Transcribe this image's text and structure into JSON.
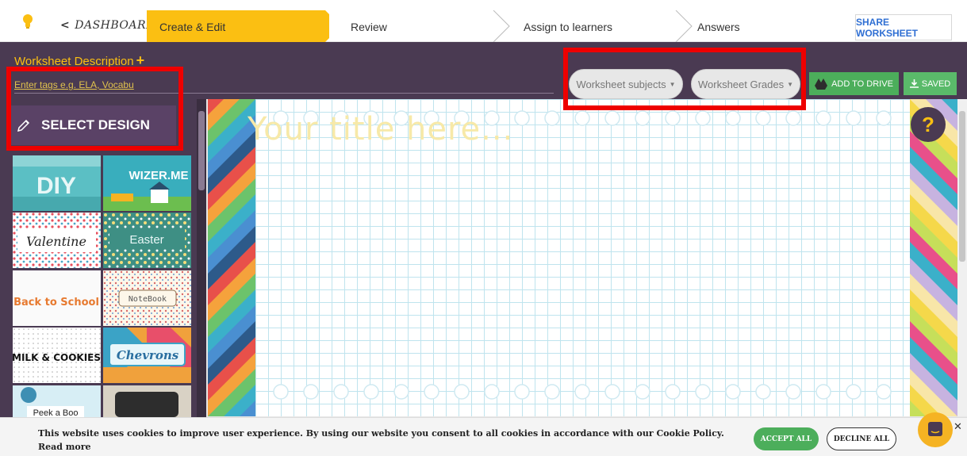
{
  "topnav": {
    "dashboard_label": "DASHBOARD",
    "steps": [
      "Create & Edit",
      "Review",
      "Assign to learners",
      "Answers"
    ],
    "share_label": "SHARE WORKSHEET"
  },
  "toolbar": {
    "description_label": "Worksheet Description",
    "tags_placeholder": "Enter tags e.g. ELA, Vocabu",
    "subjects_label": "Worksheet subjects",
    "grades_label": "Worksheet Grades",
    "drive_label": "ADD TO DRIVE",
    "saved_label": "SAVED"
  },
  "sidebar": {
    "select_design_label": "SELECT DESIGN",
    "designs": [
      "DIY",
      "WIZER.ME",
      "Valentine",
      "Easter",
      "Back to School",
      "NoteBook",
      "MILK & COOKIES",
      "Chevrons",
      "Peek a Boo",
      ""
    ]
  },
  "canvas": {
    "title_placeholder": "Your title here...",
    "help_label": "?"
  },
  "cookie": {
    "message": "This website uses cookies to improve user experience. By using our website you consent to all cookies in accordance with our Cookie Policy.",
    "read_more": "Read more",
    "accept_label": "ACCEPT ALL",
    "decline_label": "DECLINE ALL"
  },
  "colors": {
    "accent": "#fbbf12",
    "purple": "#4a3a52",
    "green": "#4cae5b",
    "annotation": "#ee0000"
  }
}
